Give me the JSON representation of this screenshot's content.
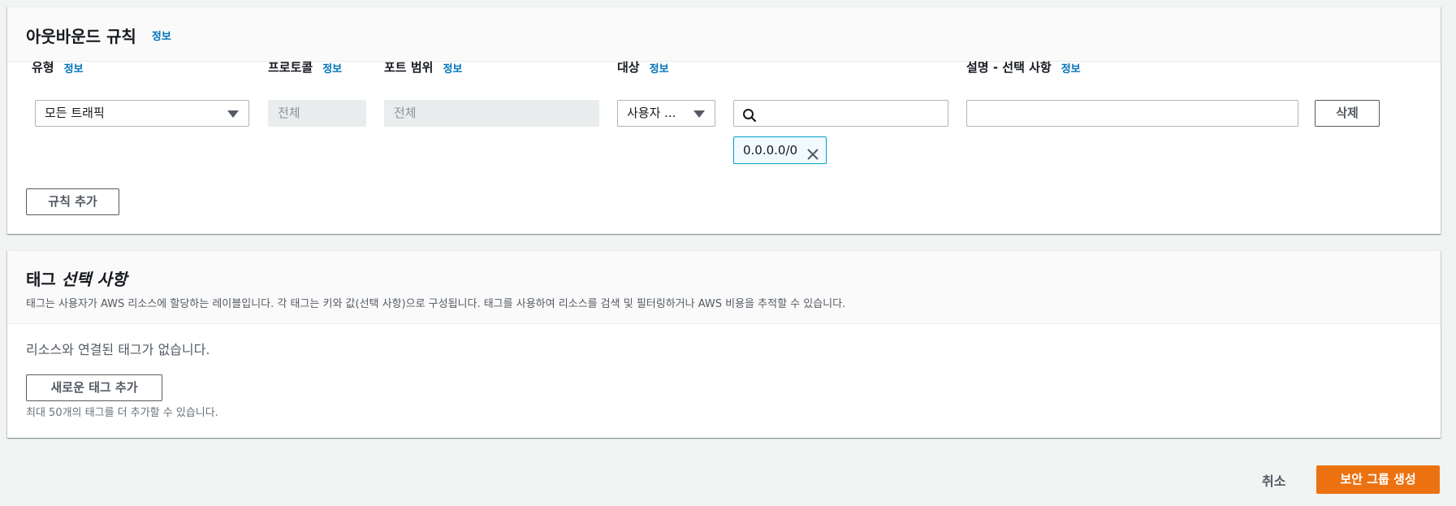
{
  "outbound": {
    "title": "아웃바운드 규칙",
    "info": "정보",
    "columns": {
      "type": "유형",
      "protocol": "프로토콜",
      "port_range": "포트 범위",
      "destination": "대상",
      "description": "설명 - 선택 사항"
    },
    "rule": {
      "type_value": "모든 트래픽",
      "protocol_placeholder": "전체",
      "port_placeholder": "전체",
      "destination_select": "사용자 ...",
      "destination_search_value": "",
      "cidr_token": "0.0.0.0/0",
      "description_value": "",
      "delete_label": "삭제"
    },
    "add_rule_label": "규칙 추가"
  },
  "tags": {
    "title_main": "태그",
    "title_optional": "선택 사항",
    "description": "태그는 사용자가 AWS 리소스에 할당하는 레이블입니다. 각 태그는 키와 값(선택 사항)으로 구성됩니다. 태그를 사용하여 리소스를 검색 및 필터링하거나 AWS 비용을 추적할 수 있습니다.",
    "empty_text": "리소스와 연결된 태그가 없습니다.",
    "add_tag_label": "새로운 태그 추가",
    "limit_text": "최대 50개의 태그를 더 추가할 수 있습니다."
  },
  "footer": {
    "cancel_label": "취소",
    "create_label": "보안 그룹 생성"
  },
  "colors": {
    "accent": "#ec7211",
    "link": "#0073bb",
    "token_border": "#00a1c9"
  },
  "icons": {
    "dropdown": "caret-down-icon",
    "search": "search-icon",
    "remove": "close-icon"
  }
}
